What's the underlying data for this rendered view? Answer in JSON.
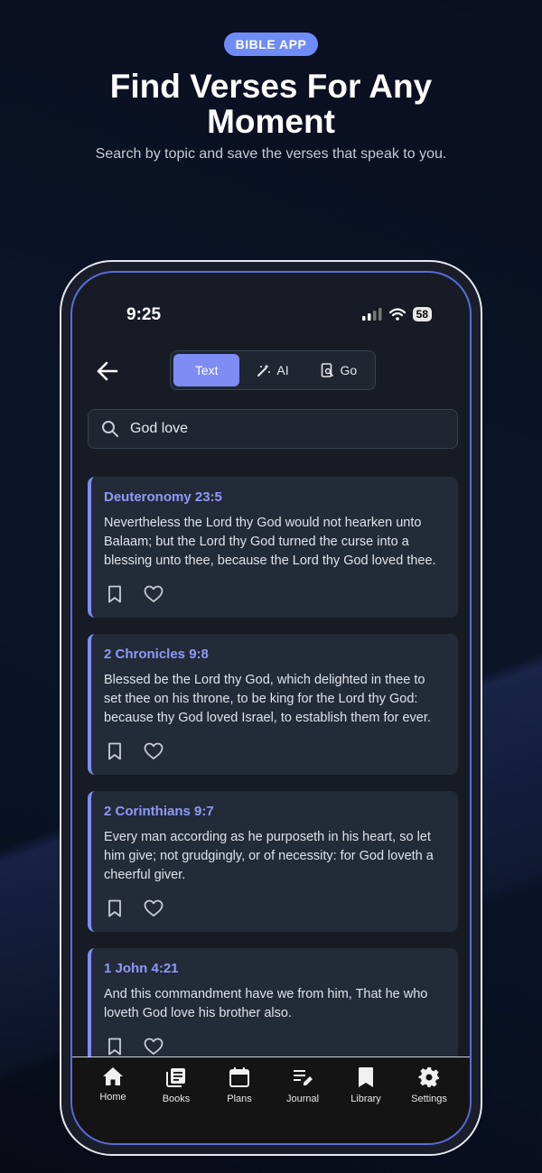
{
  "promo": {
    "badge": "BIBLE APP",
    "headline": "Find Verses For Any Moment",
    "subline": "Search by topic and save the verses that speak to you."
  },
  "status_bar": {
    "time": "9:25",
    "battery": "58"
  },
  "mode_switch": {
    "options": [
      {
        "label": "Text",
        "icon": "text",
        "active": true
      },
      {
        "label": "AI",
        "icon": "magic-wand-icon",
        "active": false
      },
      {
        "label": "Go",
        "icon": "book-search-icon",
        "active": false
      }
    ]
  },
  "search": {
    "value": "God love"
  },
  "results": [
    {
      "reference": "Deuteronomy 23:5",
      "text": "Nevertheless the Lord thy God would not hearken unto Balaam; but the Lord thy God turned the curse into a blessing unto thee, because the Lord thy God loved thee."
    },
    {
      "reference": "2 Chronicles 9:8",
      "text": "Blessed be the Lord thy God, which delighted in thee to set thee on his throne, to be king for the Lord thy God: because thy God loved Israel, to establish them for ever."
    },
    {
      "reference": "2 Corinthians 9:7",
      "text": "Every man according as he purposeth in his heart, so let him give; not grudgingly, or of necessity: for God loveth a cheerful giver."
    },
    {
      "reference": "1 John 4:21",
      "text": "And this commandment have we from him, That he who loveth God love his brother also."
    }
  ],
  "tab_bar": {
    "tabs": [
      {
        "label": "Home",
        "icon": "home-icon"
      },
      {
        "label": "Books",
        "icon": "books-icon"
      },
      {
        "label": "Plans",
        "icon": "calendar-icon"
      },
      {
        "label": "Journal",
        "icon": "journal-edit-icon"
      },
      {
        "label": "Library",
        "icon": "bookmark-icon"
      },
      {
        "label": "Settings",
        "icon": "gear-icon"
      }
    ]
  },
  "colors": {
    "accent": "#7e8cf4",
    "badge": "#6f8bf5",
    "card": "#232a38"
  }
}
